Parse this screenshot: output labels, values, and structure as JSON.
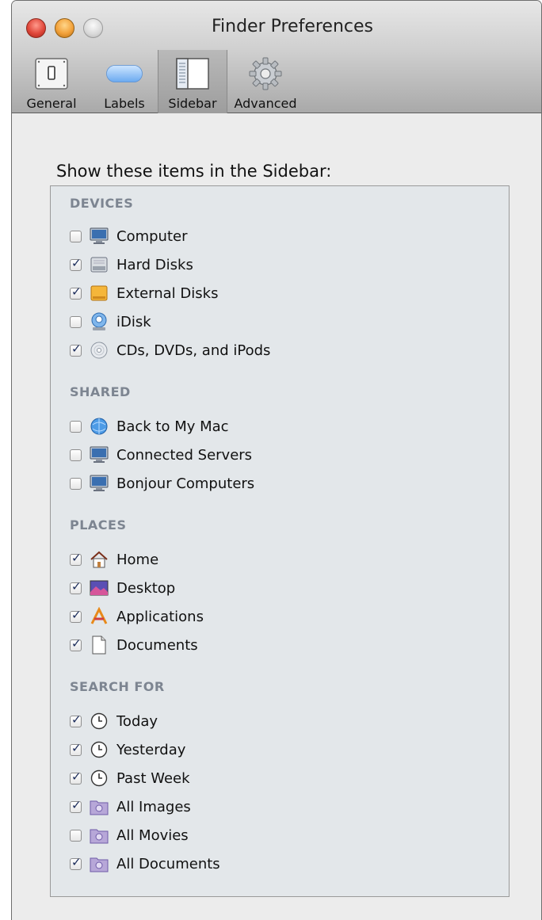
{
  "window": {
    "title": "Finder Preferences"
  },
  "toolbar": {
    "items": [
      {
        "label": "General",
        "icon": "general-switch-icon"
      },
      {
        "label": "Labels",
        "icon": "label-pill-icon"
      },
      {
        "label": "Sidebar",
        "icon": "sidebar-icon",
        "active": true
      },
      {
        "label": "Advanced",
        "icon": "gear-icon"
      }
    ]
  },
  "content": {
    "heading": "Show these items in the Sidebar:",
    "groups": [
      {
        "title": "DEVICES",
        "items": [
          {
            "label": "Computer",
            "checked": false,
            "icon": "computer-icon"
          },
          {
            "label": "Hard Disks",
            "checked": true,
            "icon": "hard-disk-icon"
          },
          {
            "label": "External Disks",
            "checked": true,
            "icon": "external-disk-icon"
          },
          {
            "label": "iDisk",
            "checked": false,
            "icon": "idisk-icon"
          },
          {
            "label": "CDs, DVDs, and iPods",
            "checked": true,
            "icon": "cd-icon"
          }
        ]
      },
      {
        "title": "SHARED",
        "items": [
          {
            "label": "Back to My Mac",
            "checked": false,
            "icon": "globe-icon"
          },
          {
            "label": "Connected Servers",
            "checked": false,
            "icon": "server-icon"
          },
          {
            "label": "Bonjour Computers",
            "checked": false,
            "icon": "computer-icon"
          }
        ]
      },
      {
        "title": "PLACES",
        "items": [
          {
            "label": "Home",
            "checked": true,
            "icon": "home-icon"
          },
          {
            "label": "Desktop",
            "checked": true,
            "icon": "desktop-icon"
          },
          {
            "label": "Applications",
            "checked": true,
            "icon": "applications-icon"
          },
          {
            "label": "Documents",
            "checked": true,
            "icon": "document-icon"
          }
        ]
      },
      {
        "title": "SEARCH FOR",
        "items": [
          {
            "label": "Today",
            "checked": true,
            "icon": "clock-icon"
          },
          {
            "label": "Yesterday",
            "checked": true,
            "icon": "clock-icon"
          },
          {
            "label": "Past Week",
            "checked": true,
            "icon": "clock-icon"
          },
          {
            "label": "All Images",
            "checked": true,
            "icon": "smart-folder-icon"
          },
          {
            "label": "All Movies",
            "checked": false,
            "icon": "smart-folder-icon"
          },
          {
            "label": "All Documents",
            "checked": true,
            "icon": "smart-folder-icon"
          }
        ]
      }
    ]
  }
}
